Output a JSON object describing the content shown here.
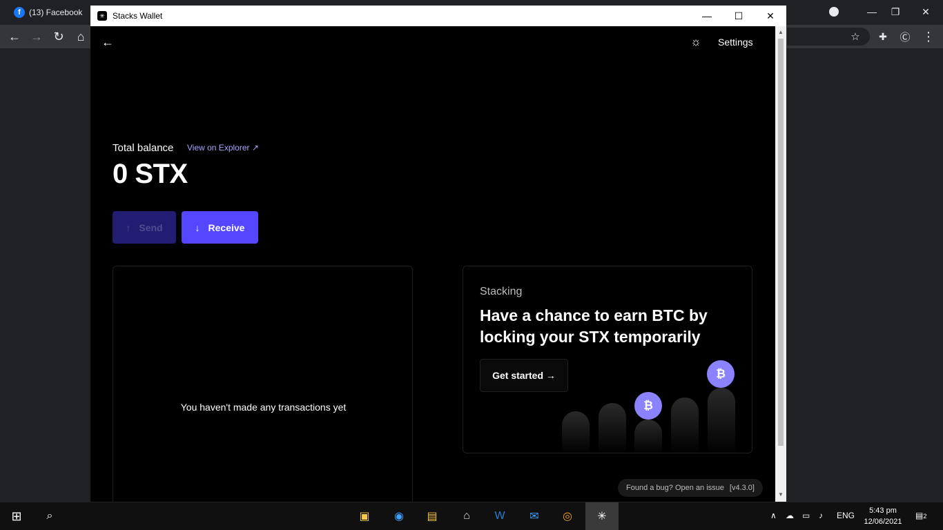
{
  "browser": {
    "tab_title": "(13) Facebook",
    "favicon_letter": "f"
  },
  "window": {
    "title": "Stacks Wallet",
    "minimize": "—",
    "maximize": "☐",
    "close": "✕"
  },
  "header": {
    "back_icon": "←",
    "theme_icon": "☼",
    "settings_label": "Settings"
  },
  "balance": {
    "label": "Total balance",
    "explorer_link": "View on Explorer ↗",
    "amount": "0 STX"
  },
  "actions": {
    "send_icon": "↑",
    "send_label": "Send",
    "receive_icon": "↓",
    "receive_label": "Receive"
  },
  "transactions": {
    "empty_text": "You haven't made any transactions yet"
  },
  "stacking": {
    "label": "Stacking",
    "heading": "Have a chance to earn BTC by locking your STX temporarily",
    "cta": "Get started →",
    "coin_symbol": "₿"
  },
  "footer": {
    "bug_text": "Found a bug? Open an issue",
    "version": "[v4.3.0]"
  },
  "taskbar": {
    "language": "ENG",
    "time": "5:43 pm",
    "date": "12/06/2021",
    "notification_count": "2"
  },
  "colors": {
    "accent": "#5546ff",
    "send_disabled": "#221d73",
    "link": "#a9a4ff",
    "btc_coin": "#8a82ff"
  }
}
